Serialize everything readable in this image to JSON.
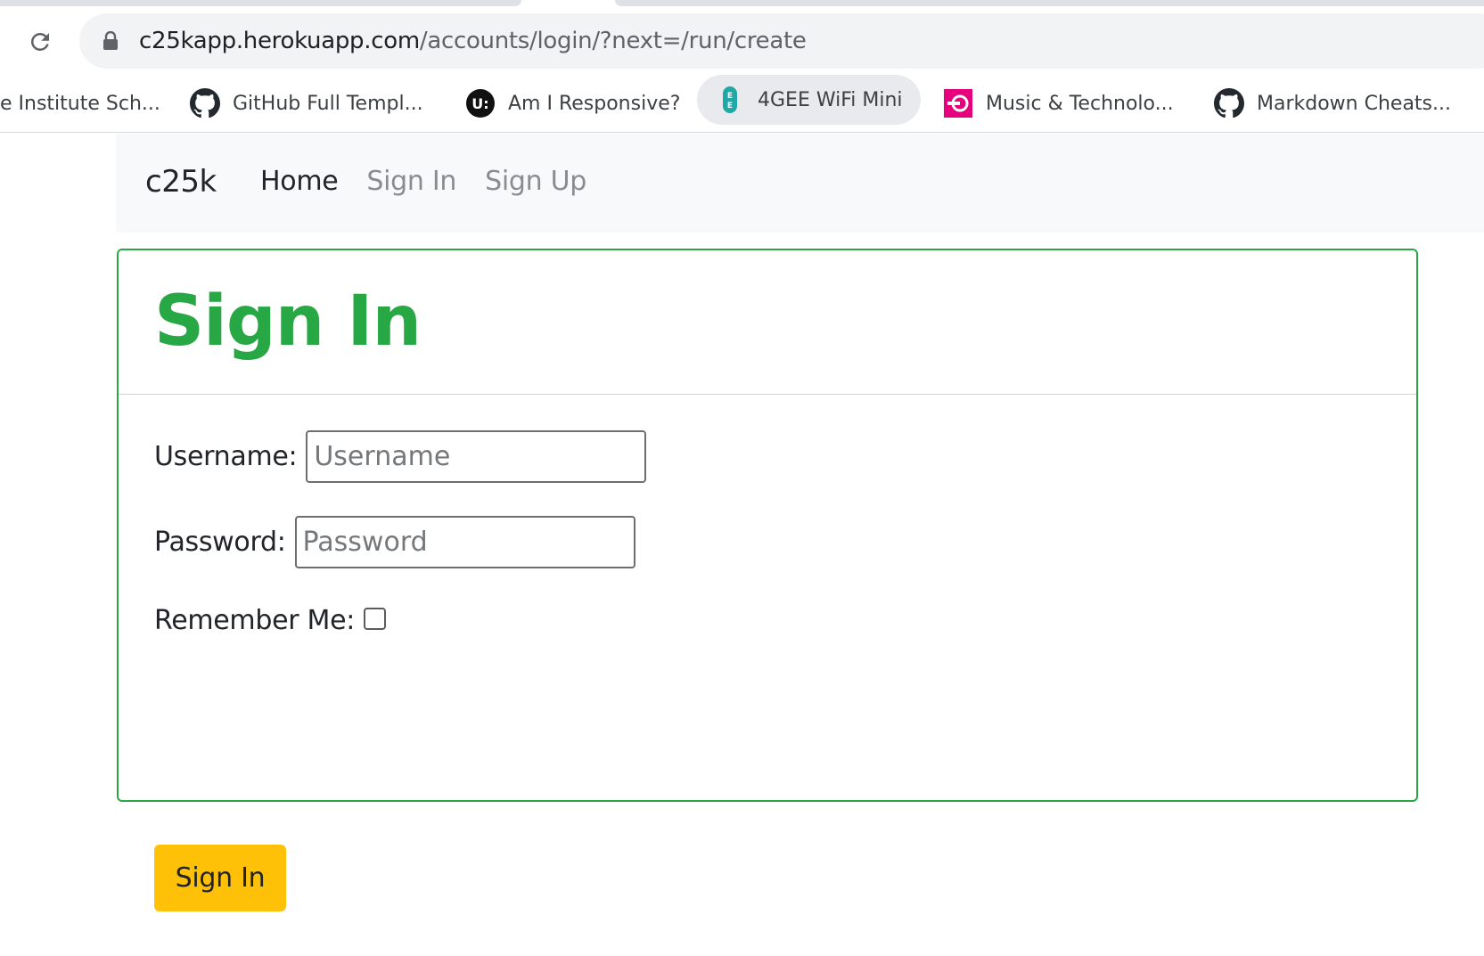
{
  "browser": {
    "url_host": "c25kapp.herokuapp.com",
    "url_path": "/accounts/login/?next=/run/create",
    "bookmarks": [
      {
        "label": "e Institute Sch...",
        "icon": "none",
        "active": false
      },
      {
        "label": "GitHub Full Templ...",
        "icon": "github-icon",
        "active": false
      },
      {
        "label": "Am I Responsive?",
        "icon": "ui-logo-icon",
        "active": false
      },
      {
        "label": "4GEE WiFi Mini",
        "icon": "ee-logo-icon",
        "active": true
      },
      {
        "label": "Music & Technolo...",
        "icon": "music-tech-logo-icon",
        "active": false
      },
      {
        "label": "Markdown Cheats...",
        "icon": "github-icon",
        "active": false
      }
    ]
  },
  "navbar": {
    "brand": "c25k",
    "links": [
      {
        "label": "Home",
        "active": true
      },
      {
        "label": "Sign In",
        "active": false
      },
      {
        "label": "Sign Up",
        "active": false
      }
    ]
  },
  "card": {
    "title": "Sign In",
    "accent_color": "#28a745",
    "form": {
      "username_label": "Username:",
      "username_placeholder": "Username",
      "username_value": "",
      "password_label": "Password:",
      "password_placeholder": "Password",
      "password_value": "",
      "remember_label": "Remember Me:",
      "remember_checked": false,
      "submit_label": "Sign In",
      "submit_color": "#ffc107"
    }
  }
}
